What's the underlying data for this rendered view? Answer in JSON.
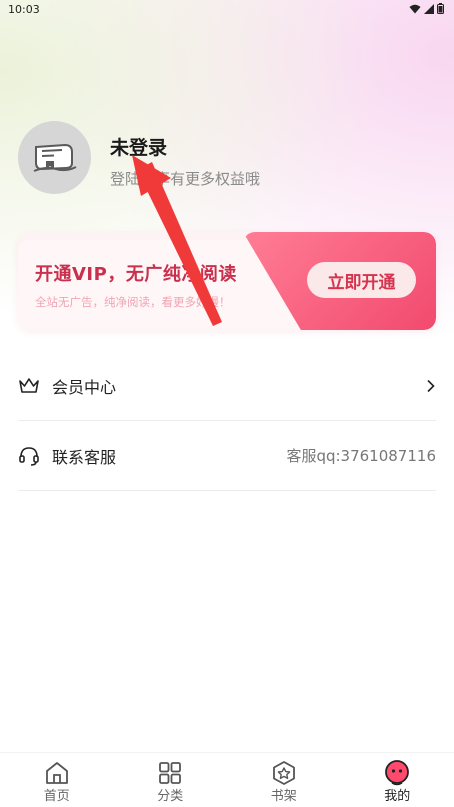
{
  "status_bar": {
    "time": "10:03"
  },
  "profile": {
    "username": "未登录",
    "login_hint": "登陆后享有更多权益哦"
  },
  "vip_banner": {
    "title": "开通VIP，无广纯净阅读",
    "subtitle": "全站无广告，纯净阅读，看更多好漫！",
    "button_label": "立即开通"
  },
  "menu": {
    "items": [
      {
        "label": "会员中心",
        "icon": "crown-icon",
        "right_text": ""
      },
      {
        "label": "联系客服",
        "icon": "headset-icon",
        "right_text": "客服qq:3761087116"
      }
    ]
  },
  "tabbar": {
    "tabs": [
      {
        "label": "首页",
        "icon": "home-icon",
        "active": false
      },
      {
        "label": "分类",
        "icon": "grid-icon",
        "active": false
      },
      {
        "label": "书架",
        "icon": "star-hexagon-icon",
        "active": false
      },
      {
        "label": "我的",
        "icon": "profile-face-icon",
        "active": true
      }
    ]
  },
  "colors": {
    "accent": "#f24a6e",
    "vip_title": "#c8304d",
    "annotation_arrow": "#f03a3a"
  }
}
